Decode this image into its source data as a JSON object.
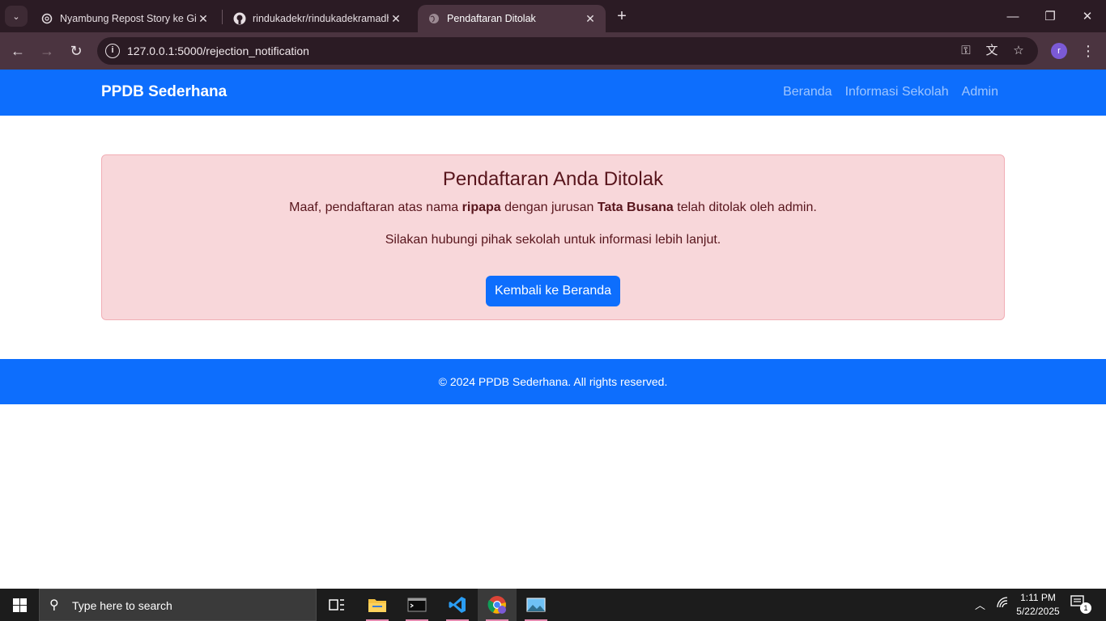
{
  "browser": {
    "tabs": [
      {
        "title": "Nyambung Repost Story ke Gith",
        "icon": "openai-icon"
      },
      {
        "title": "rindukadekr/rindukadekramadh",
        "icon": "github-icon"
      },
      {
        "title": "Pendaftaran Ditolak",
        "icon": "globe-icon",
        "active": true
      }
    ],
    "url": "127.0.0.1:5000/rejection_notification",
    "profile_initial": "r"
  },
  "navbar": {
    "brand": "PPDB Sederhana",
    "links": [
      "Beranda",
      "Informasi Sekolah",
      "Admin"
    ]
  },
  "alert": {
    "title": "Pendaftaran Anda Ditolak",
    "msg_prefix": "Maaf, pendaftaran atas nama ",
    "name": "ripapa",
    "msg_middle": " dengan jurusan ",
    "major": "Tata Busana",
    "msg_suffix": " telah ditolak oleh admin.",
    "sub": "Silakan hubungi pihak sekolah untuk informasi lebih lanjut.",
    "button": "Kembali ke Beranda"
  },
  "footer": {
    "text": "© 2024 PPDB Sederhana. All rights reserved."
  },
  "taskbar": {
    "search_placeholder": "Type here to search",
    "time": "1:11 PM",
    "date": "5/22/2025",
    "notification_count": "1"
  },
  "colors": {
    "primary": "#0d6efd",
    "alert_bg": "#f8d7da",
    "alert_text": "#58151c"
  }
}
